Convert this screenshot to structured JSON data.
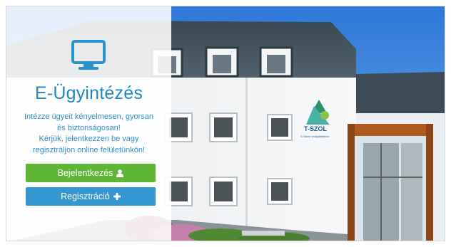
{
  "app": {
    "title": "E-Ügyintézés",
    "description_lines": [
      "Intézze ügyeit kényelmesen, gyorsan",
      "és biztonságosan!",
      "Kérjük, jelentkezzen be vagy",
      "regisztráljon online felületünkön!"
    ]
  },
  "buttons": {
    "login_label": "Bejelentkezés",
    "register_label": "Regisztráció"
  },
  "icons": {
    "hero": "monitor-icon",
    "login": "user-icon",
    "register": "plus-icon"
  },
  "building_sign": {
    "name": "T-SZOL",
    "tagline": "A Város szolgálatában"
  },
  "colors": {
    "title": "#1f88c0",
    "text": "#2a93cc",
    "login_button": "#5fb536",
    "register_button": "#3497d1"
  }
}
